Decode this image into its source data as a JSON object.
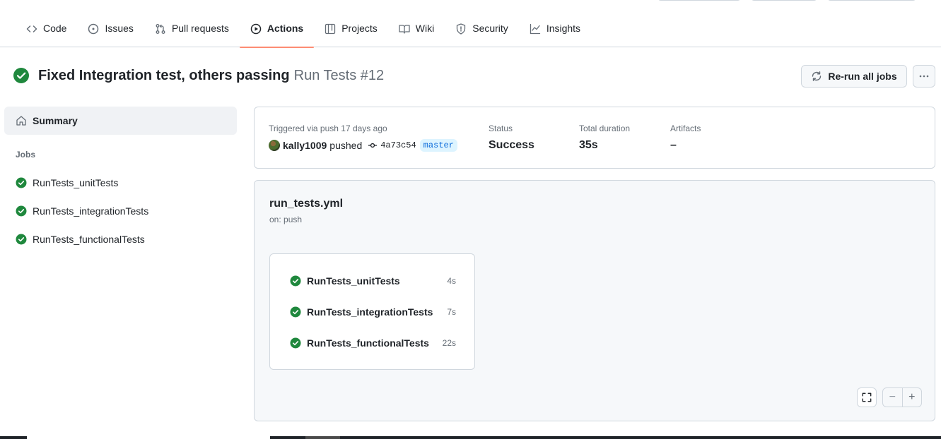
{
  "nav": {
    "tabs": [
      {
        "label": "Code",
        "icon": "code-icon"
      },
      {
        "label": "Issues",
        "icon": "issue-opened-icon"
      },
      {
        "label": "Pull requests",
        "icon": "git-pull-request-icon"
      },
      {
        "label": "Actions",
        "icon": "play-icon",
        "active": true
      },
      {
        "label": "Projects",
        "icon": "table-icon"
      },
      {
        "label": "Wiki",
        "icon": "book-icon"
      },
      {
        "label": "Security",
        "icon": "shield-icon"
      },
      {
        "label": "Insights",
        "icon": "graph-icon"
      }
    ],
    "active_underline_color": "#fd8c73"
  },
  "run": {
    "title": "Fixed Integration test, others passing",
    "workflow_and_number": "Run Tests #12",
    "status_color": "#1f883d",
    "rerun_label": "Re-run all jobs",
    "more_icon": "kebab-horizontal-icon"
  },
  "sidebar": {
    "summary_label": "Summary",
    "jobs_heading": "Jobs",
    "jobs": [
      {
        "name": "RunTests_unitTests"
      },
      {
        "name": "RunTests_integrationTests"
      },
      {
        "name": "RunTests_functionalTests"
      }
    ]
  },
  "info": {
    "trigger_text": "Triggered via push 17 days ago",
    "actor": "kally1009",
    "action": "pushed",
    "commit_sha": "4a73c54",
    "branch": "master",
    "status_label": "Status",
    "status_value": "Success",
    "duration_label": "Total duration",
    "duration_value": "35s",
    "artifacts_label": "Artifacts",
    "artifacts_value": "–"
  },
  "graph": {
    "workflow_file": "run_tests.yml",
    "trigger": "on: push",
    "jobs": [
      {
        "name": "RunTests_unitTests",
        "duration": "4s"
      },
      {
        "name": "RunTests_integrationTests",
        "duration": "7s"
      },
      {
        "name": "RunTests_functionalTests",
        "duration": "22s"
      }
    ],
    "zoom_out": "−",
    "zoom_in": "+"
  }
}
